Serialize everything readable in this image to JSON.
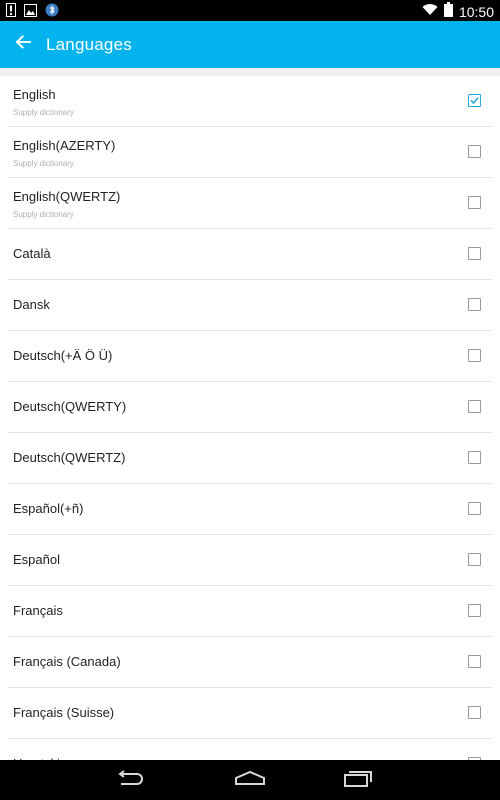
{
  "status_bar": {
    "time": "10:50",
    "left_icons": [
      "alert-icon",
      "image-icon",
      "bluetooth-icon"
    ],
    "right_icons": [
      "wifi-icon",
      "battery-icon"
    ]
  },
  "app_bar": {
    "title": "Languages",
    "back_icon": "arrow-left-icon",
    "color": "#03b3ee"
  },
  "languages": [
    {
      "label": "English",
      "sub": "Supply dictionary",
      "checked": true
    },
    {
      "label": "English(AZERTY)",
      "sub": "Supply dictionary",
      "checked": false
    },
    {
      "label": "English(QWERTZ)",
      "sub": "Supply dictionary",
      "checked": false
    },
    {
      "label": "Català",
      "sub": "",
      "checked": false
    },
    {
      "label": "Dansk",
      "sub": "",
      "checked": false
    },
    {
      "label": "Deutsch(+Ä Ö Ü)",
      "sub": "",
      "checked": false
    },
    {
      "label": "Deutsch(QWERTY)",
      "sub": "",
      "checked": false
    },
    {
      "label": "Deutsch(QWERTZ)",
      "sub": "",
      "checked": false
    },
    {
      "label": "Español(+ñ)",
      "sub": "",
      "checked": false
    },
    {
      "label": "Español",
      "sub": "",
      "checked": false
    },
    {
      "label": "Français",
      "sub": "",
      "checked": false
    },
    {
      "label": "Français (Canada)",
      "sub": "",
      "checked": false
    },
    {
      "label": "Français (Suisse)",
      "sub": "",
      "checked": false
    },
    {
      "label": "Hrvatski",
      "sub": "",
      "checked": false
    }
  ],
  "nav_bar": {
    "buttons": [
      "back-icon",
      "home-icon",
      "recents-icon"
    ]
  }
}
